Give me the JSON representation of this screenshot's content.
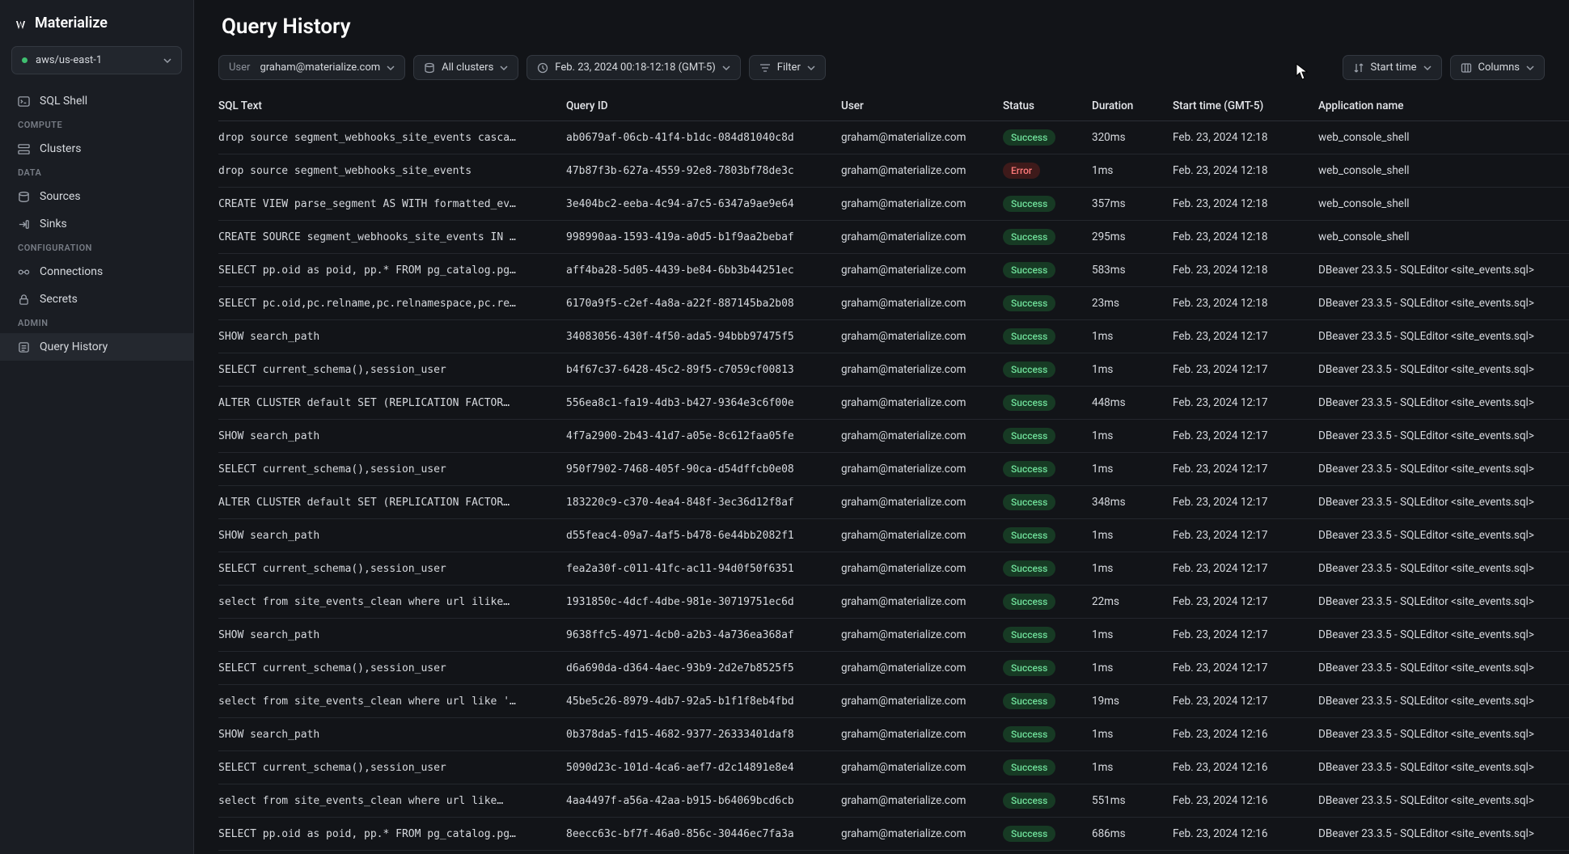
{
  "brand": "Materialize",
  "region": "aws/us-east-1",
  "sidebar": {
    "sql_shell": "SQL Shell",
    "sections": {
      "compute": "COMPUTE",
      "data": "DATA",
      "configuration": "CONFIGURATION",
      "admin": "ADMIN"
    },
    "items": {
      "clusters": "Clusters",
      "sources": "Sources",
      "sinks": "Sinks",
      "connections": "Connections",
      "secrets": "Secrets",
      "query_history": "Query History"
    }
  },
  "header": {
    "title": "Query History"
  },
  "toolbar": {
    "user_label": "User",
    "user_value": "graham@materialize.com",
    "clusters": "All clusters",
    "timerange": "Feb. 23, 2024 00:18-12:18 (GMT-5)",
    "filter": "Filter",
    "sort": "Start time",
    "columns": "Columns"
  },
  "columns": {
    "sql": "SQL Text",
    "qid": "Query ID",
    "user": "User",
    "status": "Status",
    "duration": "Duration",
    "start": "Start time (GMT-5)",
    "app": "Application name"
  },
  "rows": [
    {
      "sql": "drop source segment_webhooks_site_events casca…",
      "qid": "ab0679af-06cb-41f4-b1dc-084d81040c8d",
      "user": "graham@materialize.com",
      "status": "Success",
      "duration": "320ms",
      "start": "Feb. 23, 2024 12:18",
      "app": "web_console_shell"
    },
    {
      "sql": "drop source segment_webhooks_site_events",
      "qid": "47b87f3b-627a-4559-92e8-7803bf78de3c",
      "user": "graham@materialize.com",
      "status": "Error",
      "duration": "1ms",
      "start": "Feb. 23, 2024 12:18",
      "app": "web_console_shell"
    },
    {
      "sql": "CREATE VIEW parse_segment AS WITH formatted_ev…",
      "qid": "3e404bc2-eeba-4c94-a7c5-6347a9ae9e64",
      "user": "graham@materialize.com",
      "status": "Success",
      "duration": "357ms",
      "start": "Feb. 23, 2024 12:18",
      "app": "web_console_shell"
    },
    {
      "sql": "CREATE SOURCE segment_webhooks_site_events IN …",
      "qid": "998990aa-1593-419a-a0d5-b1f9aa2bebaf",
      "user": "graham@materialize.com",
      "status": "Success",
      "duration": "295ms",
      "start": "Feb. 23, 2024 12:18",
      "app": "web_console_shell"
    },
    {
      "sql": "SELECT pp.oid as poid, pp.* FROM pg_catalog.pg…",
      "qid": "aff4ba28-5d05-4439-be84-6bb3b44251ec",
      "user": "graham@materialize.com",
      "status": "Success",
      "duration": "583ms",
      "start": "Feb. 23, 2024 12:18",
      "app": "DBeaver 23.3.5 - SQLEditor <site_events.sql>"
    },
    {
      "sql": "SELECT pc.oid,pc.relname,pc.relnamespace,pc.re…",
      "qid": "6170a9f5-c2ef-4a8a-a22f-887145ba2b08",
      "user": "graham@materialize.com",
      "status": "Success",
      "duration": "23ms",
      "start": "Feb. 23, 2024 12:18",
      "app": "DBeaver 23.3.5 - SQLEditor <site_events.sql>"
    },
    {
      "sql": "SHOW search_path",
      "qid": "34083056-430f-4f50-ada5-94bbb97475f5",
      "user": "graham@materialize.com",
      "status": "Success",
      "duration": "1ms",
      "start": "Feb. 23, 2024 12:17",
      "app": "DBeaver 23.3.5 - SQLEditor <site_events.sql>"
    },
    {
      "sql": "SELECT current_schema(),session_user",
      "qid": "b4f67c37-6428-45c2-89f5-c7059cf00813",
      "user": "graham@materialize.com",
      "status": "Success",
      "duration": "1ms",
      "start": "Feb. 23, 2024 12:17",
      "app": "DBeaver 23.3.5 - SQLEditor <site_events.sql>"
    },
    {
      "sql": "ALTER CLUSTER default SET (REPLICATION FACTOR…",
      "qid": "556ea8c1-fa19-4db3-b427-9364e3c6f00e",
      "user": "graham@materialize.com",
      "status": "Success",
      "duration": "448ms",
      "start": "Feb. 23, 2024 12:17",
      "app": "DBeaver 23.3.5 - SQLEditor <site_events.sql>"
    },
    {
      "sql": "SHOW search_path",
      "qid": "4f7a2900-2b43-41d7-a05e-8c612faa05fe",
      "user": "graham@materialize.com",
      "status": "Success",
      "duration": "1ms",
      "start": "Feb. 23, 2024 12:17",
      "app": "DBeaver 23.3.5 - SQLEditor <site_events.sql>"
    },
    {
      "sql": "SELECT current_schema(),session_user",
      "qid": "950f7902-7468-405f-90ca-d54dffcb0e08",
      "user": "graham@materialize.com",
      "status": "Success",
      "duration": "1ms",
      "start": "Feb. 23, 2024 12:17",
      "app": "DBeaver 23.3.5 - SQLEditor <site_events.sql>"
    },
    {
      "sql": "ALTER CLUSTER default SET (REPLICATION FACTOR…",
      "qid": "183220c9-c370-4ea4-848f-3ec36d12f8af",
      "user": "graham@materialize.com",
      "status": "Success",
      "duration": "348ms",
      "start": "Feb. 23, 2024 12:17",
      "app": "DBeaver 23.3.5 - SQLEditor <site_events.sql>"
    },
    {
      "sql": "SHOW search_path",
      "qid": "d55feac4-09a7-4af5-b478-6e44bb2082f1",
      "user": "graham@materialize.com",
      "status": "Success",
      "duration": "1ms",
      "start": "Feb. 23, 2024 12:17",
      "app": "DBeaver 23.3.5 - SQLEditor <site_events.sql>"
    },
    {
      "sql": "SELECT current_schema(),session_user",
      "qid": "fea2a30f-c011-41fc-ac11-94d0f50f6351",
      "user": "graham@materialize.com",
      "status": "Success",
      "duration": "1ms",
      "start": "Feb. 23, 2024 12:17",
      "app": "DBeaver 23.3.5 - SQLEditor <site_events.sql>"
    },
    {
      "sql": "select from site_events_clean where url ilike…",
      "qid": "1931850c-4dcf-4dbe-981e-30719751ec6d",
      "user": "graham@materialize.com",
      "status": "Success",
      "duration": "22ms",
      "start": "Feb. 23, 2024 12:17",
      "app": "DBeaver 23.3.5 - SQLEditor <site_events.sql>"
    },
    {
      "sql": "SHOW search_path",
      "qid": "9638ffc5-4971-4cb0-a2b3-4a736ea368af",
      "user": "graham@materialize.com",
      "status": "Success",
      "duration": "1ms",
      "start": "Feb. 23, 2024 12:17",
      "app": "DBeaver 23.3.5 - SQLEditor <site_events.sql>"
    },
    {
      "sql": "SELECT current_schema(),session_user",
      "qid": "d6a690da-d364-4aec-93b9-2d2e7b8525f5",
      "user": "graham@materialize.com",
      "status": "Success",
      "duration": "1ms",
      "start": "Feb. 23, 2024 12:17",
      "app": "DBeaver 23.3.5 - SQLEditor <site_events.sql>"
    },
    {
      "sql": "select from site_events_clean where url like '…",
      "qid": "45be5c26-8979-4db7-92a5-b1f1f8eb4fbd",
      "user": "graham@materialize.com",
      "status": "Success",
      "duration": "19ms",
      "start": "Feb. 23, 2024 12:17",
      "app": "DBeaver 23.3.5 - SQLEditor <site_events.sql>"
    },
    {
      "sql": "SHOW search_path",
      "qid": "0b378da5-fd15-4682-9377-26333401daf8",
      "user": "graham@materialize.com",
      "status": "Success",
      "duration": "1ms",
      "start": "Feb. 23, 2024 12:16",
      "app": "DBeaver 23.3.5 - SQLEditor <site_events.sql>"
    },
    {
      "sql": "SELECT current_schema(),session_user",
      "qid": "5090d23c-101d-4ca6-aef7-d2c14891e8e4",
      "user": "graham@materialize.com",
      "status": "Success",
      "duration": "1ms",
      "start": "Feb. 23, 2024 12:16",
      "app": "DBeaver 23.3.5 - SQLEditor <site_events.sql>"
    },
    {
      "sql": "select from site_events_clean where url like…",
      "qid": "4aa4497f-a56a-42aa-b915-b64069bcd6cb",
      "user": "graham@materialize.com",
      "status": "Success",
      "duration": "551ms",
      "start": "Feb. 23, 2024 12:16",
      "app": "DBeaver 23.3.5 - SQLEditor <site_events.sql>"
    },
    {
      "sql": "SELECT pp.oid as poid, pp.* FROM pg_catalog.pg…",
      "qid": "8eecc63c-bf7f-46a0-856c-30446ec7fa3a",
      "user": "graham@materialize.com",
      "status": "Success",
      "duration": "686ms",
      "start": "Feb. 23, 2024 12:16",
      "app": "DBeaver 23.3.5 - SQLEditor <site_events.sql>"
    }
  ]
}
